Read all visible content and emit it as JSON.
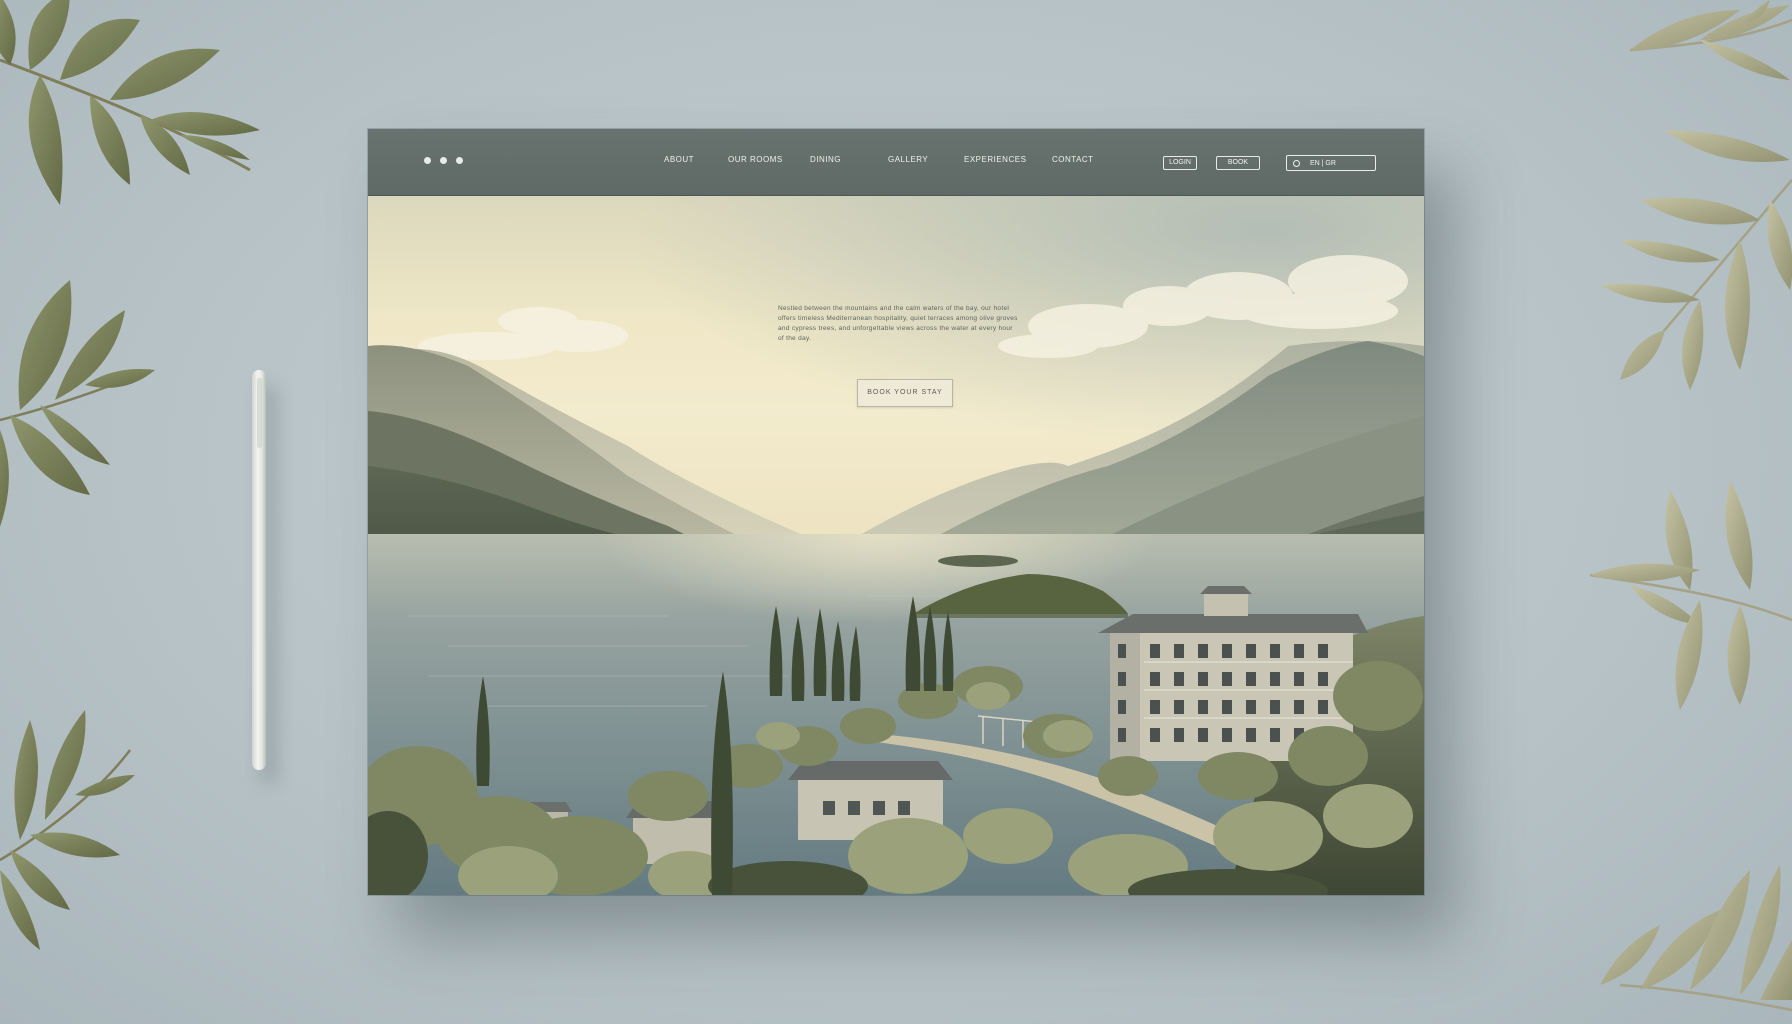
{
  "header": {
    "nav": [
      "ABOUT",
      "OUR ROOMS",
      "DINING",
      "GALLERY",
      "EXPERIENCES",
      "CONTACT"
    ],
    "login_label": "LOGIN",
    "book_label": "BOOK",
    "language_label": "EN | GR"
  },
  "hero": {
    "text": "Nestled between the mountains and the calm waters of the bay, our hotel offers timeless Mediterranean hospitality, quiet terraces among olive groves and cypress trees, and unforgettable views across the water at every hour of the day.",
    "cta_label": "BOOK YOUR STAY"
  },
  "colors": {
    "navbar": "#5f6a67",
    "background": "#b6c2c6",
    "sky_warm": "#f1e9c8",
    "water": "#7d8f93"
  }
}
